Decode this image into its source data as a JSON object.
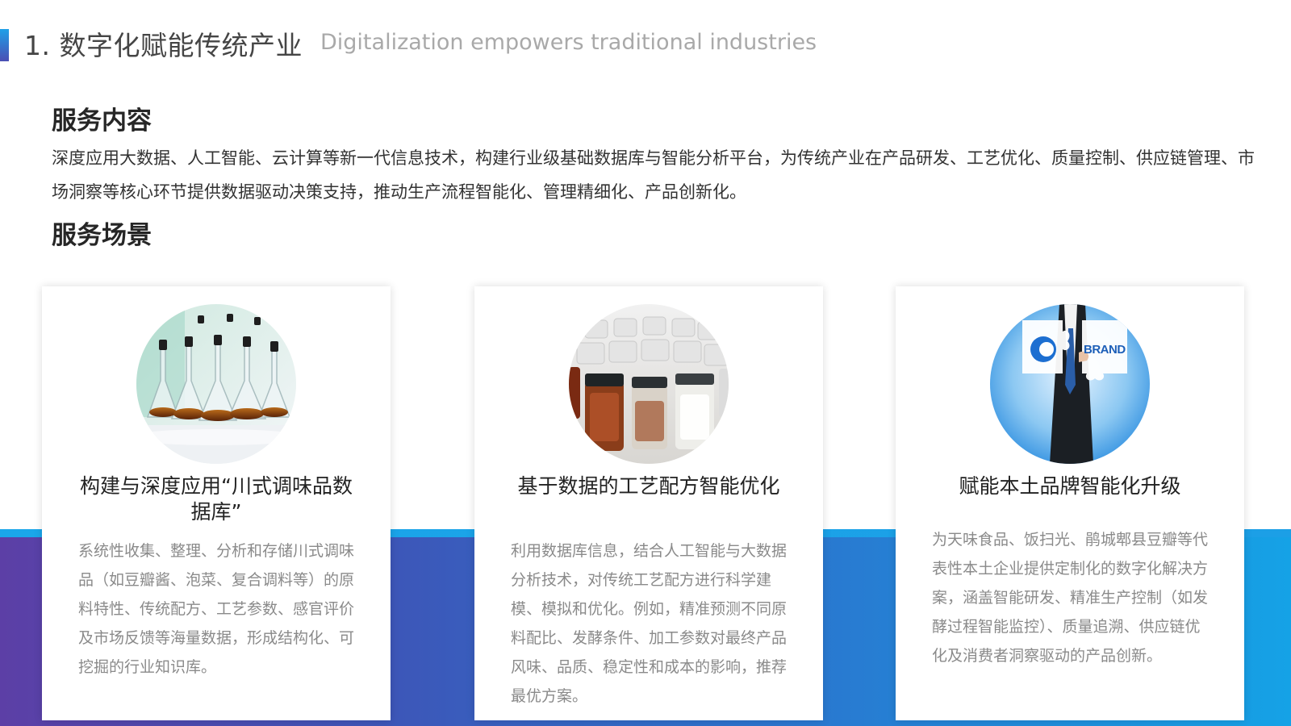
{
  "header": {
    "title": "1. 数字化赋能传统产业",
    "subtitle": "Digitalization empowers traditional industries"
  },
  "service_content": {
    "heading": "服务内容",
    "body": "深度应用大数据、人工智能、云计算等新一代信息技术，构建行业级基础数据库与智能分析平台，为传统产业在产品研发、工艺优化、质量控制、供应链管理、市场洞察等核心环节提供数据驱动决策支持，推动生产流程智能化、管理精细化、产品创新化。"
  },
  "service_scenes": {
    "heading": "服务场景"
  },
  "cards": [
    {
      "title": "构建与深度应用“川式调味品数据库”",
      "body": "系统性收集、整理、分析和存储川式调味品（如豆瓣酱、泡菜、复合调料等）的原料特性、传统配方、工艺参数、感官评价及市场反馈等海量数据，形成结构化、可挖掘的行业知识库。",
      "image": "lab-flasks-photo"
    },
    {
      "title": "基于数据的工艺配方智能优化",
      "body": "利用数据库信息，结合人工智能与大数据分析技术，对传统工艺配方进行科学建模、模拟和优化。例如，精准预测不同原料配比、发酵条件、加工参数对最终产品风味、品质、稳定性和成本的影响，推荐最优方案。",
      "image": "sample-jars-photo"
    },
    {
      "title": "赋能本土品牌智能化升级",
      "body": "为天味食品、饭扫光、鹃城郫县豆瓣等代表性本土企业提供定制化的数字化解决方案，涵盖智能研发、精准生产控制（如发酵过程智能监控）、质量追溯、供应链优化及消费者洞察驱动的产品创新。",
      "image": "brand-puzzle-photo",
      "brand_text": "BRAND"
    }
  ],
  "colors": {
    "accent_blue": "#1ea0e8",
    "accent_purple": "#4b4fb4",
    "band_left": "#5c3fa6",
    "band_right": "#15a2e6"
  }
}
